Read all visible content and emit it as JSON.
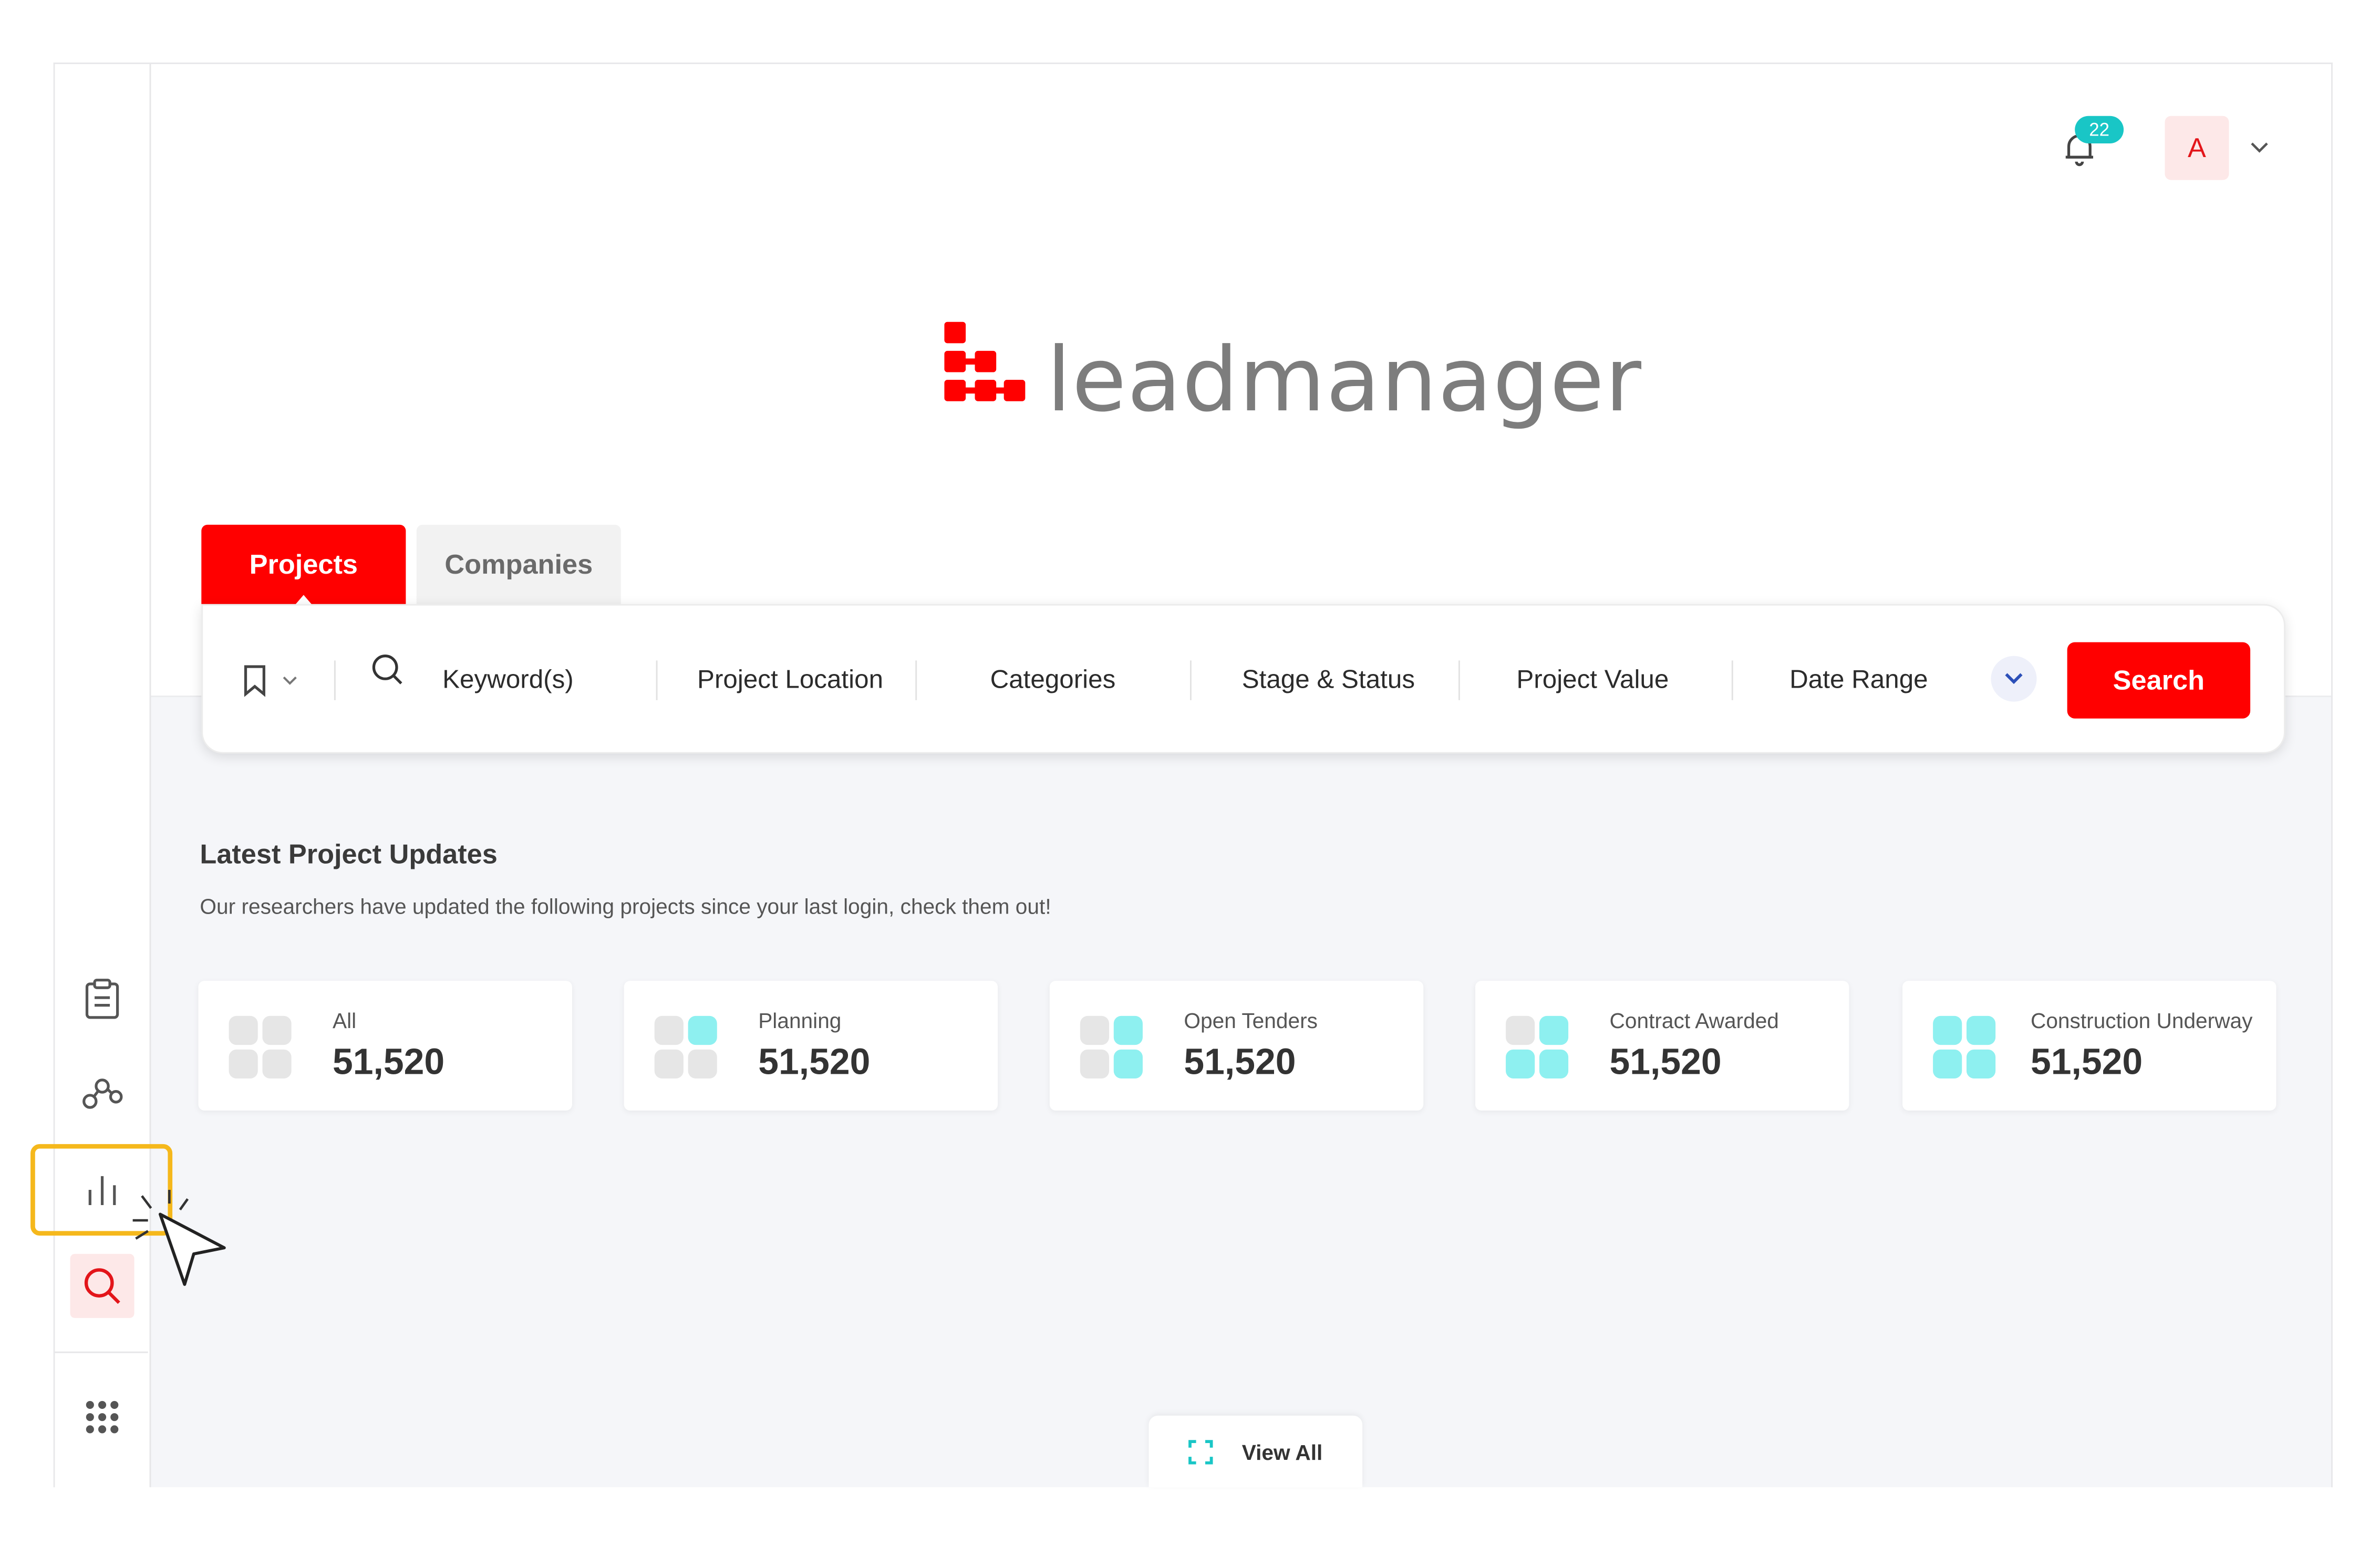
{
  "header": {
    "notification_count": "22",
    "avatar_initial": "A"
  },
  "logo": {
    "text": "leadmanager"
  },
  "tabs": [
    {
      "label": "Projects",
      "active": true
    },
    {
      "label": "Companies",
      "active": false
    }
  ],
  "search": {
    "keyword_placeholder": "Keyword(s)",
    "filters": [
      "Project Location",
      "Categories",
      "Stage & Status",
      "Project Value",
      "Date Range"
    ],
    "button_label": "Search"
  },
  "updates": {
    "title": "Latest Project Updates",
    "subtitle": "Our researchers have updated the following projects since your last login, check them out!",
    "cards": [
      {
        "label": "All",
        "value": "51,520"
      },
      {
        "label": "Planning",
        "value": "51,520"
      },
      {
        "label": "Open Tenders",
        "value": "51,520"
      },
      {
        "label": "Contract Awarded",
        "value": "51,520"
      },
      {
        "label": "Construction Underway",
        "value": "51,520"
      }
    ],
    "view_all_label": "View All"
  },
  "sidebar": {
    "items": [
      "clipboard-icon",
      "network-icon",
      "bar-chart-icon",
      "search-icon",
      "apps-grid-icon"
    ],
    "highlighted": "bar-chart-icon"
  },
  "colors": {
    "brand_red": "#ff0000",
    "teal": "#19c6c6",
    "highlight": "#f5b81c"
  }
}
